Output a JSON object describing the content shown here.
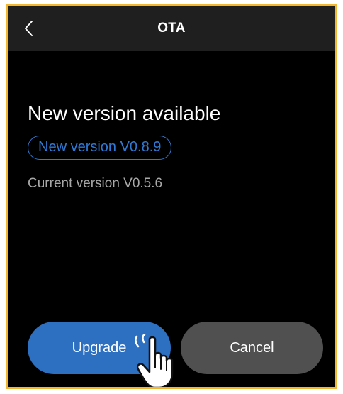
{
  "header": {
    "title": "OTA",
    "back_icon": "chevron-left-icon"
  },
  "content": {
    "title": "New version available",
    "new_version": "New version V0.8.9",
    "current_version": "Current version V0.5.6"
  },
  "actions": {
    "upgrade_label": "Upgrade",
    "cancel_label": "Cancel"
  },
  "pointer": {
    "icon": "hand-pointer-icon"
  },
  "colors": {
    "frame_border": "#f2b631",
    "accent": "#2f79d4",
    "upgrade_button": "#2d6fc0",
    "cancel_button": "#505050",
    "header_bg": "#1f1f1f",
    "screen_bg": "#000000"
  }
}
